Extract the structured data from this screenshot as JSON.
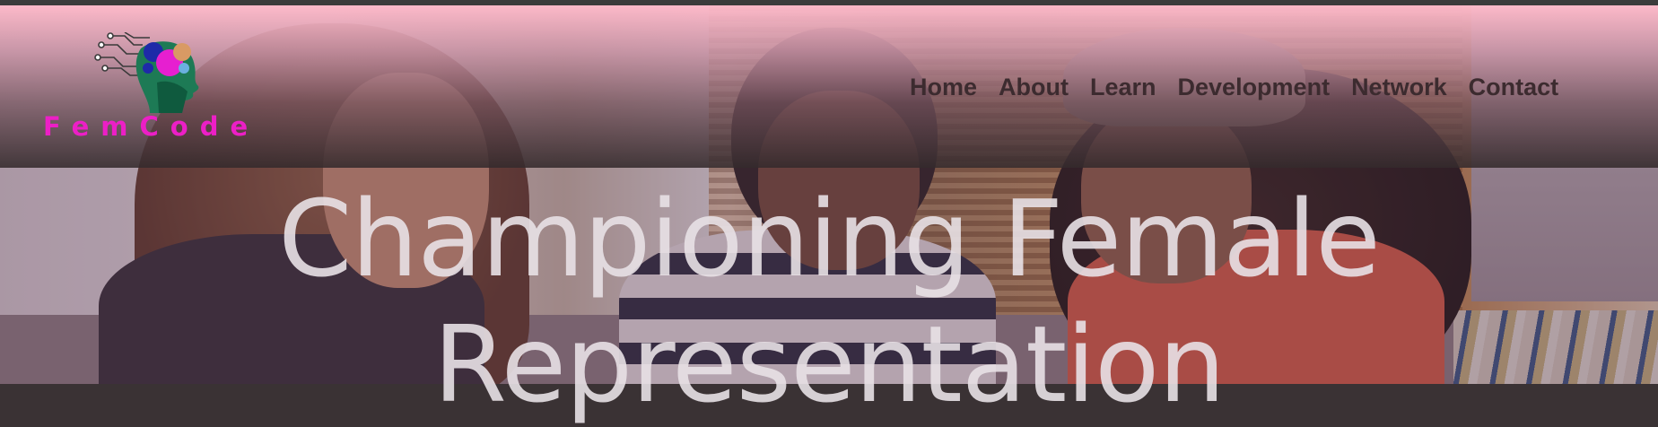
{
  "brand": {
    "name": "FemCode",
    "logo_icon": "circuit-head-icon",
    "text_color": "#ec1fc6"
  },
  "nav": {
    "items": [
      {
        "label": "Home"
      },
      {
        "label": "About"
      },
      {
        "label": "Learn"
      },
      {
        "label": "Development"
      },
      {
        "label": "Network"
      },
      {
        "label": "Contact"
      }
    ],
    "text_color": "#3c2b2f"
  },
  "hero": {
    "title": "Championing Female Representation",
    "title_color": "#e8e1e6",
    "image": "three-women-looking-at-laptop-photo"
  },
  "colors": {
    "header_top": "#ffbaca",
    "header_bottom": "#342a2c",
    "top_strip": "#3b3b3b"
  }
}
